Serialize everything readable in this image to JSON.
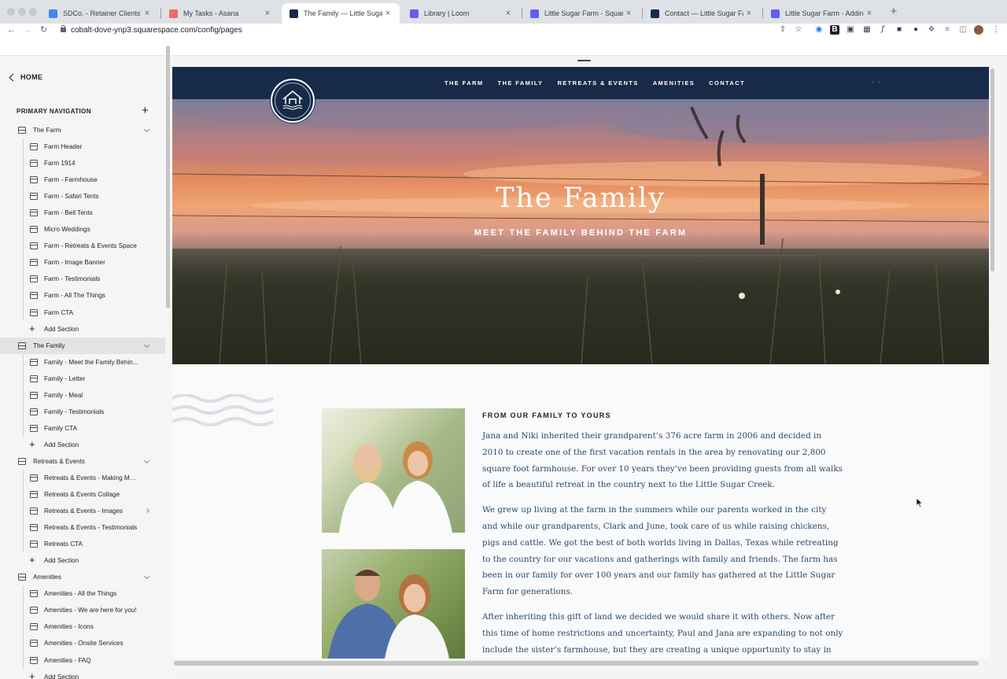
{
  "browser": {
    "tabs": [
      {
        "title": "SDCo. - Retainer Clients - Goo",
        "favicon_color": "#4285f4",
        "active": false
      },
      {
        "title": "My Tasks - Asana",
        "favicon_color": "#f06a6a",
        "active": false
      },
      {
        "title": "The Family — Little Sugar Farm",
        "favicon_color": "#172a48",
        "active": true
      },
      {
        "title": "Library | Loom",
        "favicon_color": "#625df5",
        "active": false
      },
      {
        "title": "Little Sugar Farm - Squarespa",
        "favicon_color": "#625df5",
        "active": false
      },
      {
        "title": "Contact — Little Sugar Farm -",
        "favicon_color": "#172a48",
        "active": false
      },
      {
        "title": "Little Sugar Farm - Adding/Edi",
        "favicon_color": "#625df5",
        "active": false
      }
    ],
    "url": "cobalt-dove-ynp3.squarespace.com/config/pages",
    "extension_labels": [
      "B",
      "f"
    ]
  },
  "sidebar": {
    "back_label": "HOME",
    "section_title": "PRIMARY NAVIGATION",
    "rows": [
      {
        "kind": "folder",
        "label": "The Farm"
      },
      {
        "kind": "page",
        "label": "Farm Header"
      },
      {
        "kind": "page",
        "label": "Farm 1914"
      },
      {
        "kind": "page",
        "label": "Farm - Farmhouse"
      },
      {
        "kind": "page",
        "label": "Farm - Safari Tents"
      },
      {
        "kind": "page",
        "label": "Farm - Bell Tents"
      },
      {
        "kind": "page",
        "label": "Micro Weddings"
      },
      {
        "kind": "page",
        "label": "Farm - Retreats & Events Space"
      },
      {
        "kind": "page",
        "label": "Farm - Image Banner"
      },
      {
        "kind": "page",
        "label": "Farm - Testimonials"
      },
      {
        "kind": "page",
        "label": "Farm - All The Things"
      },
      {
        "kind": "page",
        "label": "Farm CTA"
      },
      {
        "kind": "add",
        "label": "Add Section"
      },
      {
        "kind": "folder",
        "label": "The Family",
        "selected": true
      },
      {
        "kind": "page",
        "label": "Family - Meet the Family Behin..."
      },
      {
        "kind": "page",
        "label": "Family - Letter"
      },
      {
        "kind": "page",
        "label": "Family - Meal"
      },
      {
        "kind": "page",
        "label": "Family - Testimonials"
      },
      {
        "kind": "page",
        "label": "Family CTA"
      },
      {
        "kind": "add",
        "label": "Add Section"
      },
      {
        "kind": "folder",
        "label": "Retreats & Events"
      },
      {
        "kind": "page",
        "label": "Retreats & Events - Making Me..."
      },
      {
        "kind": "page",
        "label": "Retreats & Events Collage"
      },
      {
        "kind": "page",
        "label": "Retreats & Events - Images",
        "has_children": true
      },
      {
        "kind": "page",
        "label": "Retreats & Events - Testimonials"
      },
      {
        "kind": "page",
        "label": "Retreats CTA"
      },
      {
        "kind": "add",
        "label": "Add Section"
      },
      {
        "kind": "folder",
        "label": "Amenities"
      },
      {
        "kind": "page",
        "label": "Amenities - All the Things"
      },
      {
        "kind": "page",
        "label": "Amenities - We are here for you!"
      },
      {
        "kind": "page",
        "label": "Amenities - Icons"
      },
      {
        "kind": "page",
        "label": "Amenities - Onsite Services"
      },
      {
        "kind": "page",
        "label": "Amenities - FAQ"
      },
      {
        "kind": "add",
        "label": "Add Section"
      }
    ]
  },
  "site": {
    "nav": [
      "THE FARM",
      "THE FAMILY",
      "RETREATS & EVENTS",
      "AMENITIES",
      "CONTACT"
    ],
    "hero_title": "The Family",
    "hero_subtitle": "MEET THE FAMILY BEHIND THE FARM",
    "section_heading": "FROM OUR FAMILY TO YOURS",
    "paragraphs": [
      "Jana and Niki inherited their grandparent’s 376 acre farm in 2006 and decided in 2010 to create one of the first vacation rentals in the area by renovating our 2,800 square foot farmhouse. For over 10 years they’ve been providing guests from all walks of life a beautiful retreat in the country next to the Little Sugar Creek.",
      "We grew up living at the farm in the summers while our parents worked in the city and while our grandparents, Clark and June, took care of us while raising chickens, pigs and cattle. We got the best of both worlds living in Dallas, Texas while retreating to the country for our vacations and gatherings with family and friends. The farm has been in our family for over 100 years and our family has gathered at the Little Sugar Farm for generations.",
      "After inheriting this gift of land we decided we would share it with others. Now after this time of home restrictions and uncertainty, Paul and Jana are expanding to not only include the sister’s farmhouse, but they are creating a unique opportunity to stay in"
    ],
    "colors": {
      "header": "#172a48",
      "body_text": "#2c4a66"
    }
  }
}
